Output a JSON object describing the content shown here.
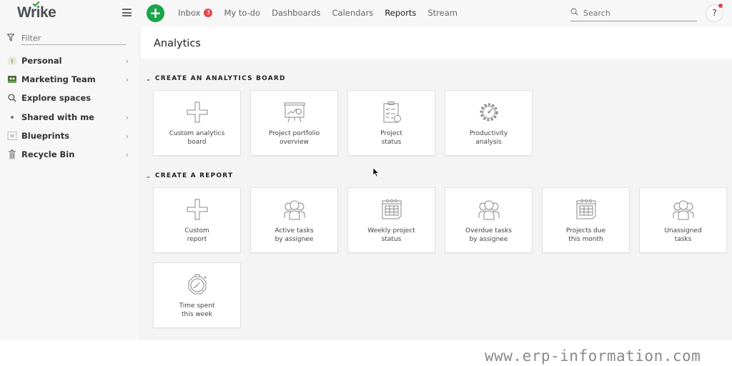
{
  "app": {
    "logo": "Wrike",
    "brand_color": "#1aa548",
    "badge_color": "#e2474b"
  },
  "topbar": {
    "add_label": "+",
    "nav": [
      {
        "label": "Inbox",
        "badge": "3",
        "active": false
      },
      {
        "label": "My to-do",
        "active": false
      },
      {
        "label": "Dashboards",
        "active": false
      },
      {
        "label": "Calendars",
        "active": false
      },
      {
        "label": "Reports",
        "active": true
      },
      {
        "label": "Stream",
        "active": false
      }
    ],
    "search_placeholder": "Search",
    "help_label": "?"
  },
  "sidebar": {
    "filter_placeholder": "Filter",
    "items": [
      {
        "label": "Personal",
        "icon": "personal-space-icon",
        "has_chevron": true
      },
      {
        "label": "Marketing Team",
        "icon": "team-space-icon",
        "has_chevron": true
      },
      {
        "label": "Explore spaces",
        "icon": "search-icon",
        "has_chevron": false
      },
      {
        "label": "Shared with me",
        "icon": "dot-icon",
        "has_chevron": true
      },
      {
        "label": "Blueprints",
        "icon": "blueprint-icon",
        "has_chevron": true
      },
      {
        "label": "Recycle Bin",
        "icon": "trash-icon",
        "has_chevron": true
      }
    ]
  },
  "main": {
    "title": "Analytics",
    "sections": [
      {
        "heading": "CREATE AN ANALYTICS BOARD",
        "tiles": [
          {
            "label": "Custom analytics\nboard",
            "icon": "plus-icon"
          },
          {
            "label": "Project portfolio\noverview",
            "icon": "presentation-board-icon"
          },
          {
            "label": "Project\nstatus",
            "icon": "clipboard-checklist-icon"
          },
          {
            "label": "Productivity\nanalysis",
            "icon": "gear-gauge-icon"
          }
        ]
      },
      {
        "heading": "CREATE A REPORT",
        "tiles": [
          {
            "label": "Custom\nreport",
            "icon": "plus-icon"
          },
          {
            "label": "Active tasks\nby assignee",
            "icon": "people-group-icon"
          },
          {
            "label": "Weekly project\nstatus",
            "icon": "calendar-icon"
          },
          {
            "label": "Overdue tasks\nby assignee",
            "icon": "people-group-icon"
          },
          {
            "label": "Projects due\nthis month",
            "icon": "calendar-icon"
          },
          {
            "label": "Unassigned\ntasks",
            "icon": "people-group-icon"
          },
          {
            "label": "Time spent\nthis week",
            "icon": "stopwatch-icon"
          }
        ]
      }
    ]
  },
  "watermark": "www.erp-information.com"
}
